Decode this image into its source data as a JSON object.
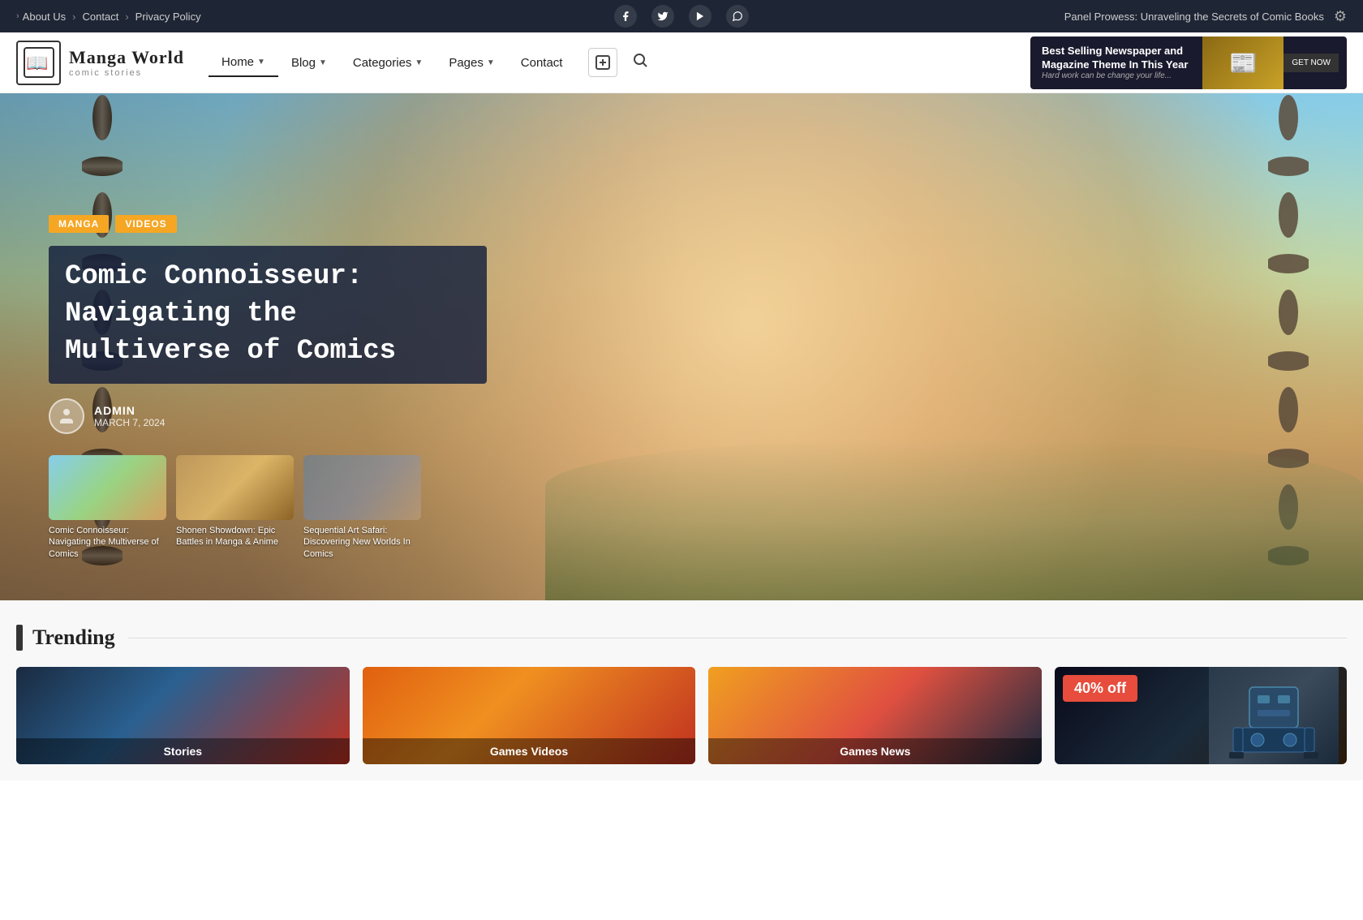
{
  "topbar": {
    "breadcrumb": [
      {
        "label": "About Us",
        "href": "#"
      },
      {
        "label": "Contact",
        "href": "#"
      },
      {
        "label": "Privacy Policy",
        "href": "#"
      }
    ],
    "social": [
      {
        "name": "facebook",
        "icon": "f",
        "href": "#"
      },
      {
        "name": "twitter",
        "icon": "t",
        "href": "#"
      },
      {
        "name": "youtube",
        "icon": "y",
        "href": "#"
      },
      {
        "name": "whatsapp",
        "icon": "w",
        "href": "#"
      }
    ],
    "ticker_text": "Panel Prowess: Unraveling the Secrets of Comic Books"
  },
  "header": {
    "logo_title": "Manga World",
    "logo_subtitle": "comic stories",
    "nav": [
      {
        "label": "Home",
        "active": true,
        "has_dropdown": true
      },
      {
        "label": "Blog",
        "has_dropdown": true
      },
      {
        "label": "Categories",
        "has_dropdown": true
      },
      {
        "label": "Pages",
        "has_dropdown": true
      },
      {
        "label": "Contact",
        "has_dropdown": false
      }
    ],
    "ad_title": "Best Selling Newspaper and Magazine Theme In This Year",
    "ad_subtitle": "Hard work can be change your life...",
    "ad_btn": "GET NOW"
  },
  "hero": {
    "tags": [
      "MANGA",
      "VIDEOS"
    ],
    "title": "Comic Connoisseur: Navigating the Multiverse of Comics",
    "author_name": "ADMIN",
    "author_date": "MARCH 7, 2024",
    "thumbnails": [
      {
        "caption": "Comic Connoisseur: Navigating the Multiverse of Comics"
      },
      {
        "caption": "Shonen Showdown: Epic Battles in Manga & Anime"
      },
      {
        "caption": "Sequential Art Safari: Discovering New Worlds In Comics"
      }
    ]
  },
  "trending": {
    "title": "Trending",
    "cards": [
      {
        "label": "Stories"
      },
      {
        "label": "Games Videos"
      },
      {
        "label": "Games News"
      }
    ],
    "ad_discount": "40% off"
  }
}
